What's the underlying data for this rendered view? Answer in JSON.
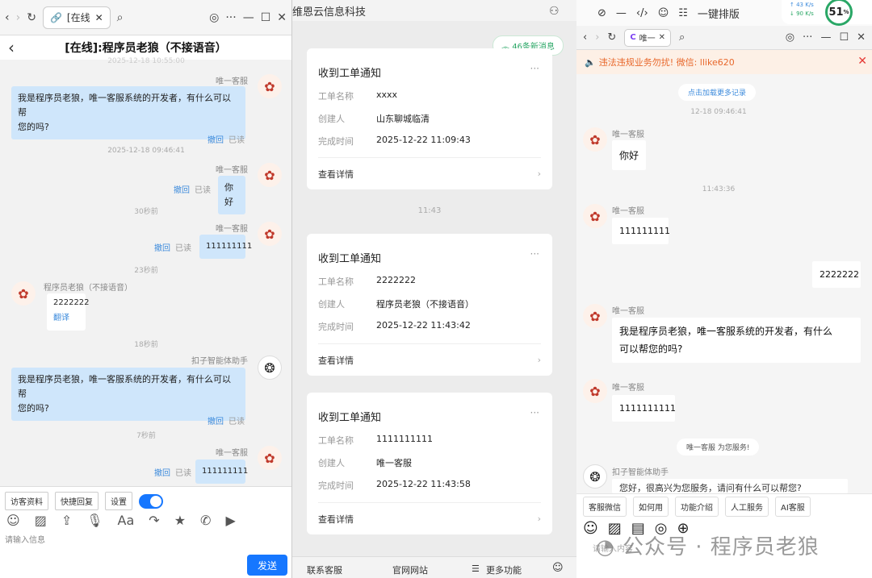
{
  "left": {
    "tab_label": "[在线",
    "title": "[在线]:程序员老狼（不接语音）",
    "ts0": "2025-12-18 10:55:00",
    "m1": {
      "name": "唯一客服",
      "text1": "我是程序员老狼，唯一客服系统的开发者，有什么可以帮",
      "text2": "您的吗?",
      "revoke": "撤回",
      "read": "已读"
    },
    "ts1": "2025-12-18 09:46:41",
    "m2": {
      "name": "唯一客服",
      "text": "你好",
      "revoke": "撤回",
      "read": "已读"
    },
    "ts2": "30秒前",
    "m3": {
      "name": "唯一客服",
      "text": "111111111",
      "revoke": "撤回",
      "read": "已读"
    },
    "ts3": "23秒前",
    "m4": {
      "name": "程序员老狼（不接语音）",
      "text": "2222222",
      "translate": "翻译"
    },
    "ts4": "18秒前",
    "m5": {
      "name": "扣子智能体助手",
      "text1": "我是程序员老狼，唯一客服系统的开发者，有什么可以帮",
      "text2": "您的吗?",
      "revoke": "撤回",
      "read": "已读"
    },
    "ts5": "7秒前",
    "m6": {
      "name": "唯一客服",
      "text": "111111111",
      "revoke": "撤回",
      "read": "已读"
    },
    "tools": {
      "visitor": "访客资料",
      "quick": "快捷回复",
      "settings": "设置"
    },
    "placeholder": "请输入信息",
    "send": "发送"
  },
  "mid": {
    "title": "维恩云信息科技",
    "new_msgs": "46条新消息",
    "time_mid": "11:43",
    "card_title": "收到工单通知",
    "k_name": "工单名称",
    "k_creator": "创建人",
    "k_done": "完成时间",
    "detail": "查看详情",
    "cards": [
      {
        "name": "xxxx",
        "creator": "山东聊城临清",
        "done": "2025-12-22 11:09:43"
      },
      {
        "name": "2222222",
        "creator": "程序员老狼（不接语音）",
        "done": "2025-12-22 11:43:42"
      },
      {
        "name": "1111111111",
        "creator": "唯一客服",
        "done": "2025-12-22 11:43:58"
      }
    ],
    "nav": {
      "contact": "联系客服",
      "site": "官网网站",
      "more": "更多功能"
    }
  },
  "right": {
    "topbar": {
      "layout": "一键排版",
      "net_up": "43 K/s",
      "net_down": "90 K/s",
      "percent": "51"
    },
    "tab_label": "唯一",
    "warning": "违法违规业务勿扰! 微信: llike620",
    "load_more": "点击加载更多记录",
    "ts1": "12-18 09:46:41",
    "m1": {
      "name": "唯一客服",
      "text": "你好"
    },
    "ts2": "11:43:36",
    "m2": {
      "name": "唯一客服",
      "text": "111111111"
    },
    "m3": {
      "text": "2222222"
    },
    "m4": {
      "name": "唯一客服",
      "text1": "我是程序员老狼，唯一客服系统的开发者，有什么",
      "text2": "可以帮您的吗?"
    },
    "m5": {
      "name": "唯一客服",
      "text": "1111111111"
    },
    "serving": "唯一客服 为您服务!",
    "m6": {
      "name": "扣子智能体助手",
      "text": "您好，很高兴为您服务，请问有什么可以帮您?"
    },
    "quick": [
      "客服微信",
      "如何用",
      "功能介绍",
      "人工服务",
      "AI客服"
    ],
    "placeholder": "请输入内容",
    "watermark": "公众号 · 程序员老狼"
  }
}
